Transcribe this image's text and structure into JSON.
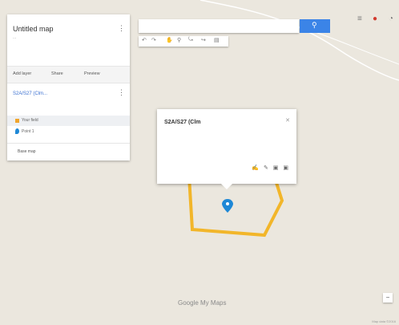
{
  "map": {
    "road_labels": [
      "",
      ""
    ],
    "google_logo": "Google My Maps",
    "attribution": "Map data ©2016"
  },
  "panel": {
    "title": "Untitled map",
    "subtitle": "...",
    "description": "",
    "more_icon": "more-vert-icon",
    "actions": [
      "Add layer",
      "Share",
      "Preview"
    ],
    "layer": {
      "name": "S2A/S27 (Clm...",
      "style_link": "",
      "items": [
        {
          "label": "Your field",
          "icon": "polygon-square-icon",
          "selected": true
        },
        {
          "label": "Point 1",
          "icon": "map-pin-icon",
          "selected": false
        }
      ]
    },
    "basemap_label": "Base map"
  },
  "search": {
    "placeholder": ""
  },
  "toolbar": {
    "icons": [
      "undo-icon",
      "redo-icon",
      "hand-icon",
      "marker-icon",
      "line-icon",
      "route-icon",
      "ruler-icon"
    ]
  },
  "popup": {
    "title": "S2A/S27 (Clm",
    "description": "",
    "footer_left": "",
    "footer_right": "",
    "close_icon": "close-icon"
  },
  "colors": {
    "polygon": "#f2b62a",
    "pin": "#1e88d6",
    "search_button": "#3b84e7",
    "map_background": "#ebe7de"
  }
}
